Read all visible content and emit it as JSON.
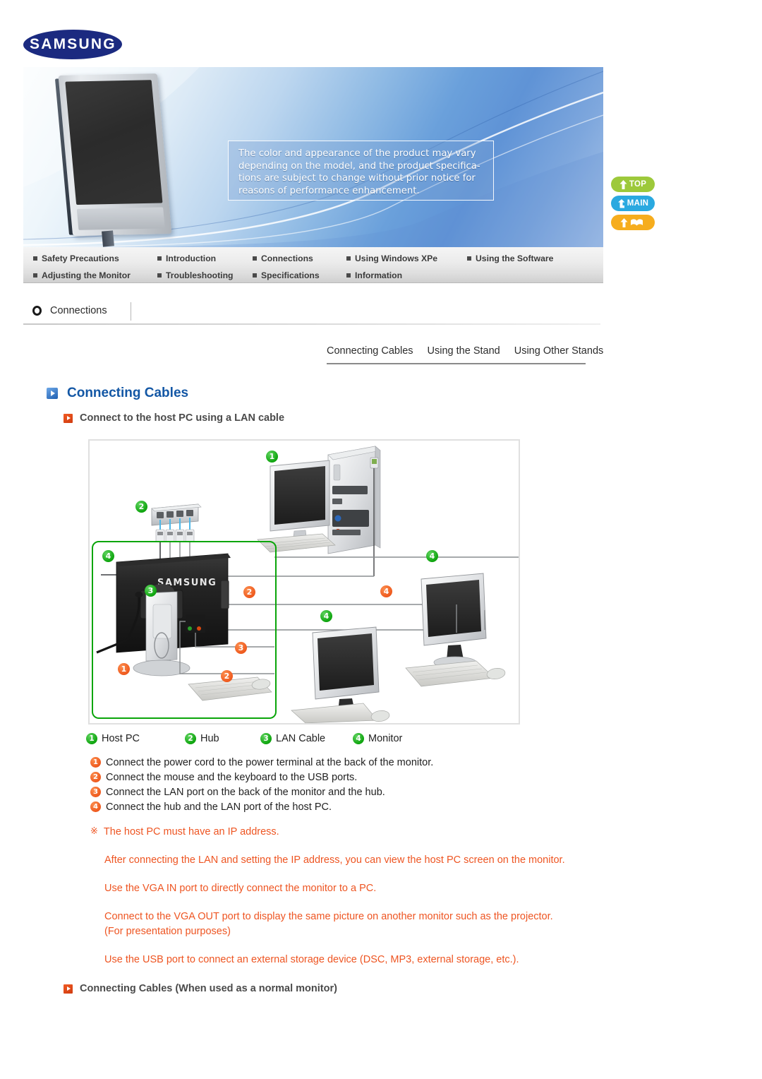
{
  "brand": {
    "logo_text": "SAMSUNG",
    "logo_color": "#1b2a80"
  },
  "banner": {
    "notice_lines": [
      "The color and appearance of the product may vary",
      "depending on the model, and the product specifica-",
      "tions are subject to change without prior notice for",
      "reasons of performance enhancement."
    ]
  },
  "side_buttons": [
    {
      "label": "TOP",
      "icon": "arrow-up-icon",
      "color": "#9dc93b"
    },
    {
      "label": "MAIN",
      "icon": "arrow-curved-up-icon",
      "color": "#2aa9e0"
    },
    {
      "label": "",
      "icon": "arrow-up-mail-icon",
      "color": "#f6ad1e"
    }
  ],
  "nav": {
    "row1": [
      "Safety Precautions",
      "Introduction",
      "Connections",
      "Using Windows XPe",
      "Using the Software"
    ],
    "row2": [
      "Adjusting the Monitor",
      "Troubleshooting",
      "Specifications",
      "Information"
    ]
  },
  "breadcrumb": {
    "icon": "ring-icon",
    "label": "Connections"
  },
  "tabs": [
    {
      "label": "Connecting Cables",
      "active": true
    },
    {
      "label": "Using the Stand",
      "active": false
    },
    {
      "label": "Using Other Stands",
      "active": false
    }
  ],
  "headings": {
    "main": "Connecting Cables",
    "sub1": "Connect to the host PC using a LAN cable",
    "sub2": "Connecting Cables (When used as a normal monitor)"
  },
  "diagram": {
    "callouts": [
      {
        "n": "1",
        "type": "green",
        "name": "host-pc"
      },
      {
        "n": "2",
        "type": "green",
        "name": "hub"
      },
      {
        "n": "3",
        "type": "green",
        "name": "lan-cable"
      },
      {
        "n": "4",
        "type": "green",
        "name": "monitor-main"
      },
      {
        "n": "4",
        "type": "green",
        "name": "monitor-right"
      },
      {
        "n": "4",
        "type": "green",
        "name": "monitor-center"
      },
      {
        "n": "1",
        "type": "orange",
        "name": "power-cord"
      },
      {
        "n": "2",
        "type": "orange",
        "name": "usb-side"
      },
      {
        "n": "2",
        "type": "orange",
        "name": "usb-keyboard-mouse"
      },
      {
        "n": "3",
        "type": "orange",
        "name": "lan-port"
      },
      {
        "n": "4",
        "type": "orange",
        "name": "hub-to-host-pc"
      }
    ],
    "monitor_brand": "SAMSUNG"
  },
  "legend": [
    {
      "n": "1",
      "label": "Host PC"
    },
    {
      "n": "2",
      "label": "Hub"
    },
    {
      "n": "3",
      "label": "LAN Cable"
    },
    {
      "n": "4",
      "label": "Monitor"
    }
  ],
  "steps": [
    {
      "n": "1",
      "text": "Connect the power cord to the power terminal at the back of the monitor."
    },
    {
      "n": "2",
      "text": "Connect the mouse and the keyboard to the USB ports."
    },
    {
      "n": "3",
      "text": "Connect the LAN port on the back of the monitor and the hub."
    },
    {
      "n": "4",
      "text": "Connect the hub and the LAN port of the host PC."
    }
  ],
  "notes": {
    "mark": "※",
    "first": "The host PC must have an IP address.",
    "paragraphs": [
      "After connecting the LAN and setting the IP address, you can view the host PC screen on the monitor.",
      "Use the VGA IN port to directly connect the monitor to a PC.",
      "Connect to the VGA OUT port to display the same picture on another monitor such as the projector. (For presentation purposes)",
      "Use the USB port to connect an external storage device (DSC, MP3, external storage, etc.)."
    ],
    "color": "#ee5522"
  }
}
